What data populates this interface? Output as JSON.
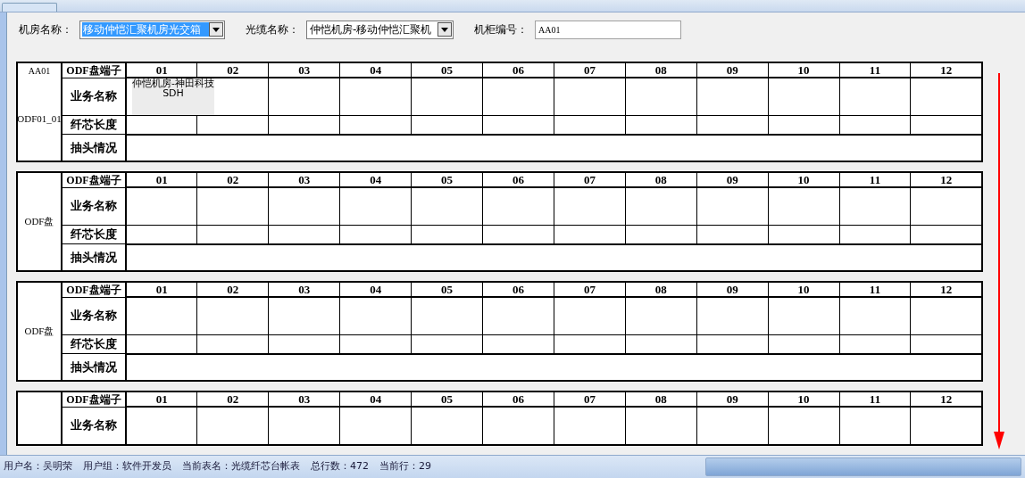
{
  "form": [
    {
      "kind": "select",
      "label": "机房名称：",
      "value": "移动仲恺汇聚机房光交箱",
      "selected": true
    },
    {
      "kind": "select",
      "label": "光缆名称：",
      "value": "仲恺机房-移动仲恺汇聚机",
      "selected": false
    },
    {
      "kind": "input",
      "label": "机柜编号：",
      "value": "AA01"
    }
  ],
  "panels": [
    {
      "rack": "AA01",
      "label": "ODF01_01",
      "rows": [
        {
          "kind": "ports",
          "label": "ODF盘端子",
          "cells": [
            "01",
            "02",
            "03",
            "04",
            "05",
            "06",
            "07",
            "08",
            "09",
            "10",
            "11",
            "12"
          ]
        },
        {
          "kind": "service",
          "label": "业务名称",
          "cells": [
            "仲恺机房-神田科技 SDH"
          ]
        },
        {
          "kind": "length",
          "label": "纤芯长度"
        },
        {
          "kind": "tap",
          "label": "抽头情况"
        }
      ]
    },
    {
      "label": "ODF盘",
      "rows": [
        {
          "kind": "ports",
          "label": "ODF盘端子",
          "cells": [
            "01",
            "02",
            "03",
            "04",
            "05",
            "06",
            "07",
            "08",
            "09",
            "10",
            "11",
            "12"
          ]
        },
        {
          "kind": "service",
          "label": "业务名称",
          "cells": []
        },
        {
          "kind": "length",
          "label": "纤芯长度"
        },
        {
          "kind": "tap",
          "label": "抽头情况"
        }
      ]
    },
    {
      "label": "ODF盘",
      "rows": [
        {
          "kind": "ports",
          "label": "ODF盘端子",
          "cells": [
            "01",
            "02",
            "03",
            "04",
            "05",
            "06",
            "07",
            "08",
            "09",
            "10",
            "11",
            "12"
          ]
        },
        {
          "kind": "service",
          "label": "业务名称",
          "cells": []
        },
        {
          "kind": "length",
          "label": "纤芯长度"
        },
        {
          "kind": "tap",
          "label": "抽头情况"
        }
      ]
    },
    {
      "rows": [
        {
          "kind": "ports",
          "label": "ODF盘端子",
          "cells": [
            "01",
            "02",
            "03",
            "04",
            "05",
            "06",
            "07",
            "08",
            "09",
            "10",
            "11",
            "12"
          ]
        },
        {
          "kind": "service",
          "label": "业务名称",
          "cells": []
        }
      ]
    }
  ],
  "status_bar": [
    "用户名：吴明荣",
    "用户组：软件开发员",
    "当前表名：光缆纤芯台帐表",
    "总行数：472",
    "当前行：29"
  ]
}
